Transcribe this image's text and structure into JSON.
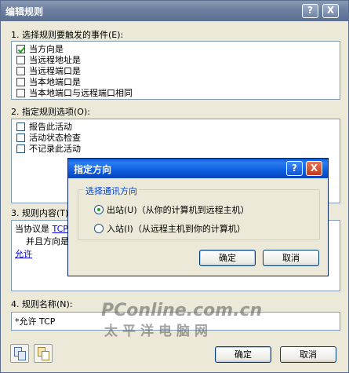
{
  "window": {
    "title": "编辑规则",
    "help_label": "?",
    "close_label": "X"
  },
  "section1": {
    "label": "1. 选择规则要触发的事件(E):",
    "items": [
      {
        "label": "当方向是",
        "checked": true
      },
      {
        "label": "当远程地址是",
        "checked": false
      },
      {
        "label": "当远程端口是",
        "checked": false
      },
      {
        "label": "当本地端口是",
        "checked": false
      },
      {
        "label": "当本地端口与远程端口相同",
        "checked": false
      }
    ]
  },
  "section2": {
    "label": "2. 指定规则选项(O):",
    "items": [
      {
        "label": "报告此活动",
        "checked": false
      },
      {
        "label": "活动状态检查",
        "checked": false
      },
      {
        "label": "不记录此活动",
        "checked": false
      }
    ]
  },
  "section3": {
    "label": "3. 规则内容(T)",
    "line1_prefix": "当协议是",
    "line1_link": "TCP",
    "line2": "并且方向是",
    "line3_link": "允许"
  },
  "section4": {
    "label": "4. 规则名称(N):",
    "name_value": "*允许 TCP"
  },
  "bottom": {
    "ok_label": "确定",
    "cancel_label": "取消"
  },
  "direction_dialog": {
    "title": "指定方向",
    "help_label": "?",
    "close_label": "X",
    "group_label": "选择通讯方向",
    "options": [
      {
        "label": "出站(U)（从你的计算机到远程主机）",
        "selected": true
      },
      {
        "label": "入站(I)（从远程主机到你的计算机）",
        "selected": false
      }
    ],
    "ok_label": "确定",
    "cancel_label": "取消"
  },
  "watermark": {
    "line1": "PConline.com.cn",
    "line2": "太平洋电脑网"
  }
}
